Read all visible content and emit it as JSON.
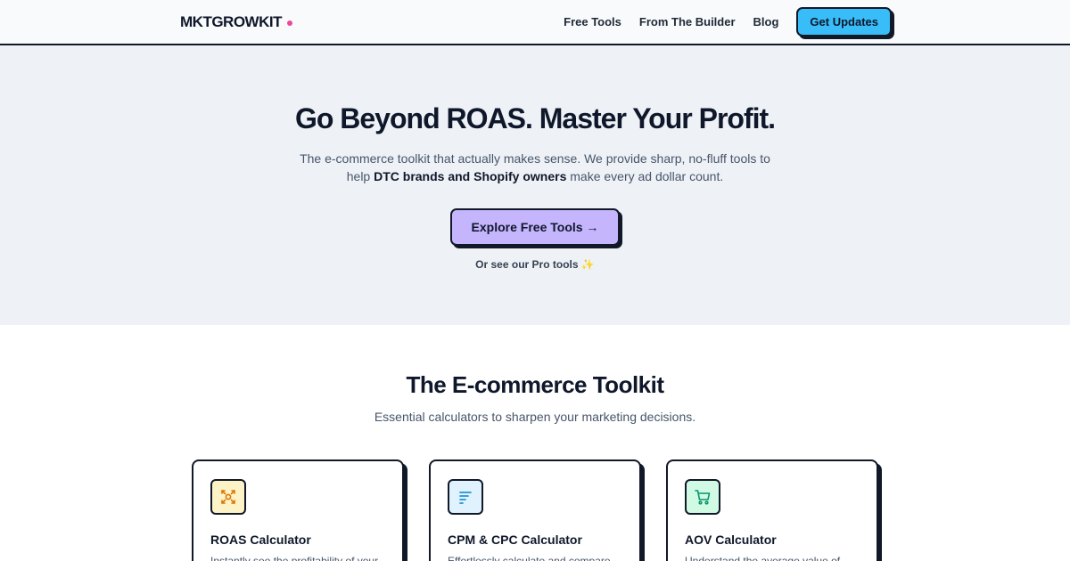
{
  "header": {
    "logo": "MKTGROWKIT",
    "nav": [
      "Free Tools",
      "From The Builder",
      "Blog"
    ],
    "cta": "Get Updates"
  },
  "hero": {
    "title": "Go Beyond ROAS. Master Your Profit.",
    "subtitle_line1": "The e-commerce toolkit that actually makes sense. We provide sharp, no-fluff tools to",
    "subtitle_pre": "help ",
    "subtitle_bold": "DTC brands and Shopify owners",
    "subtitle_post": " make every ad dollar count.",
    "button": "Explore Free Tools →",
    "pro_link": "Or see our Pro tools",
    "pro_sparkle": "✨"
  },
  "toolkit": {
    "title": "The E-commerce Toolkit",
    "subtitle": "Essential calculators to sharpen your marketing decisions.",
    "cards": [
      {
        "icon": "roas-target-icon",
        "icon_bg": "#fef3c7",
        "icon_color": "#d97706",
        "title": "ROAS Calculator",
        "desc": "Instantly see the profitability of your"
      },
      {
        "icon": "bars-text-icon",
        "icon_bg": "#e0f2fe",
        "icon_color": "#0284c7",
        "title": "CPM & CPC Calculator",
        "desc": "Effortlessly calculate and compare"
      },
      {
        "icon": "shopping-cart-icon",
        "icon_bg": "#d1fae5",
        "icon_color": "#059669",
        "title": "AOV Calculator",
        "desc": "Understand the average value of"
      }
    ]
  },
  "colors": {
    "accent_pink": "#ec4899",
    "cta_blue": "#38bdf8",
    "explore_purple": "#c4b5fd",
    "hero_bg": "#eef2f7"
  }
}
